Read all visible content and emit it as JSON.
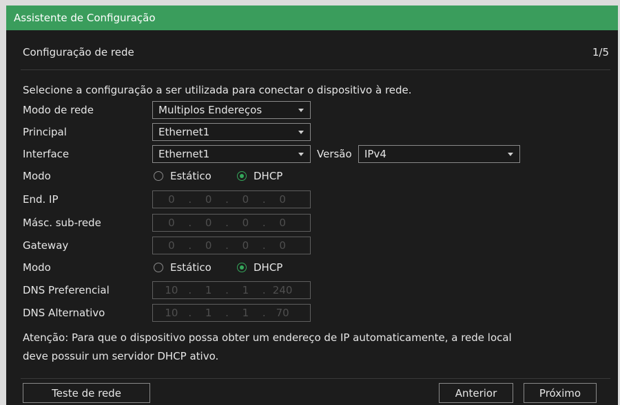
{
  "window": {
    "title": "Assistente de Configuração"
  },
  "header": {
    "title": "Configuração de rede",
    "step": "1/5"
  },
  "intro": "Selecione a configuração a ser utilizada para conectar o dispositivo à rede.",
  "form": {
    "network_mode": {
      "label": "Modo de rede",
      "value": "Multiplos Endereços"
    },
    "primary": {
      "label": "Principal",
      "value": "Ethernet1"
    },
    "interface": {
      "label": "Interface",
      "value": "Ethernet1"
    },
    "version": {
      "label": "Versão",
      "value": "IPv4"
    },
    "ip_mode": {
      "label": "Modo",
      "options": [
        {
          "label": "Estático",
          "checked": false
        },
        {
          "label": "DHCP",
          "checked": true
        }
      ]
    },
    "ip_separator": ".",
    "ip_address": {
      "label": "End. IP",
      "octets": [
        "0",
        "0",
        "0",
        "0"
      ],
      "enabled": false
    },
    "subnet_mask": {
      "label": "Másc. sub-rede",
      "octets": [
        "0",
        "0",
        "0",
        "0"
      ],
      "enabled": false
    },
    "gateway": {
      "label": "Gateway",
      "octets": [
        "0",
        "0",
        "0",
        "0"
      ],
      "enabled": false
    },
    "dns_mode": {
      "label": "Modo",
      "options": [
        {
          "label": "Estático",
          "checked": false
        },
        {
          "label": "DHCP",
          "checked": true
        }
      ]
    },
    "dns_preferred": {
      "label": "DNS Preferencial",
      "octets": [
        "10",
        "1",
        "1",
        "240"
      ],
      "enabled": false
    },
    "dns_alternate": {
      "label": "DNS Alternativo",
      "octets": [
        "10",
        "1",
        "1",
        "70"
      ],
      "enabled": false
    }
  },
  "note": {
    "lines": [
      "Atenção: Para que o dispositivo possa obter um endereço de IP automaticamente, a rede local",
      "deve possuir um servidor DHCP ativo."
    ]
  },
  "footer": {
    "network_test_button": "Teste de rede",
    "previous_button": "Anterior",
    "next_button": "Próximo"
  },
  "icons": {
    "dropdown": "dropdown-arrow-icon",
    "radio_on": "radio-checked-icon",
    "radio_off": "radio-unchecked-icon"
  },
  "colors": {
    "title_bar": "#3a9d5c",
    "background": "#1c1c1c",
    "text": "#e6e6e6",
    "accent": "#35a85b",
    "disabled_text": "#4f4f4f",
    "border": "#8a8a8a"
  }
}
